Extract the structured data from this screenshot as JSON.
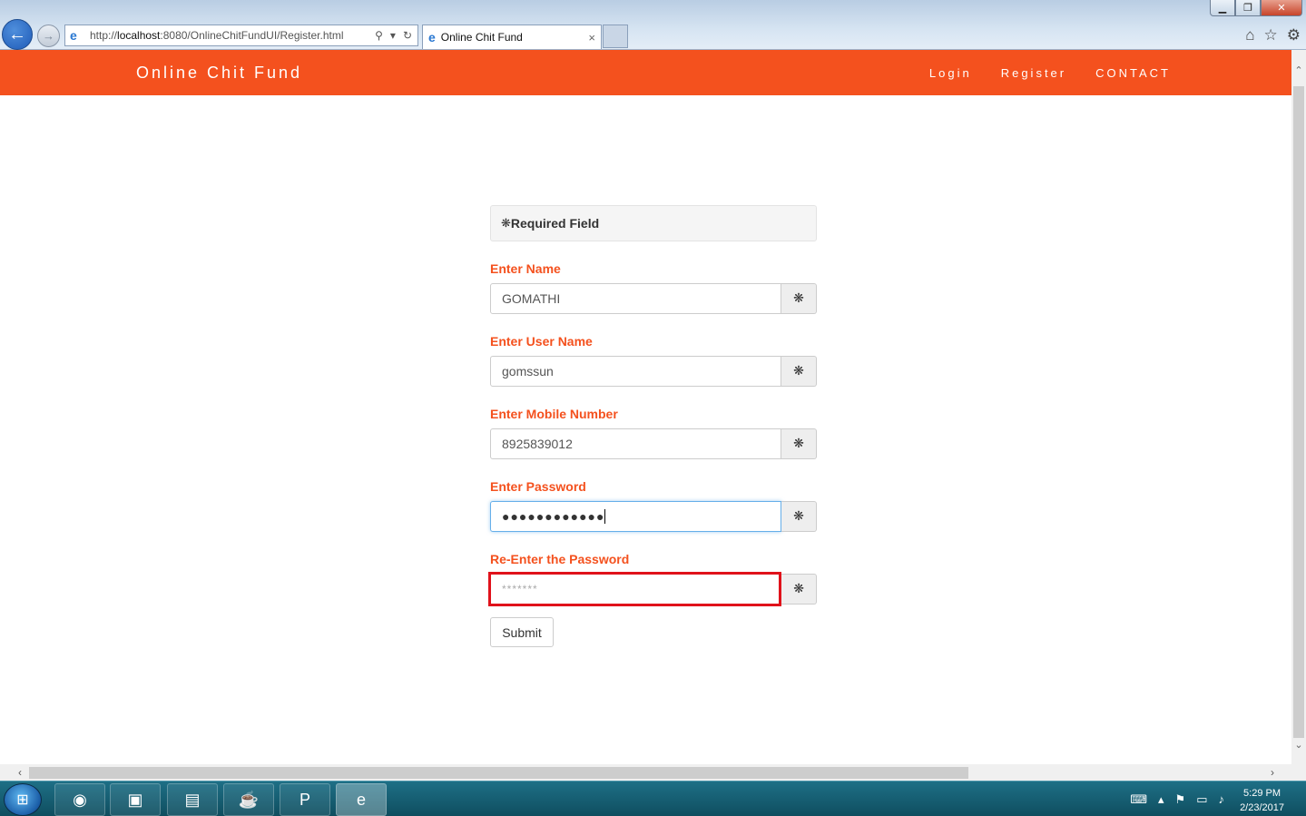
{
  "browser": {
    "url_prefix": "http://",
    "url_host": "localhost",
    "url_rest": ":8080/OnlineChitFundUI/Register.html",
    "tab_title": "Online Chit Fund",
    "tab_close": "×"
  },
  "site": {
    "brand": "Online Chit Fund",
    "nav": [
      "Login",
      "Register",
      "CONTACT"
    ]
  },
  "form": {
    "required_note": "Required Field",
    "required_mark": "❋",
    "fields": [
      {
        "label": "Enter Name",
        "value": "GOMATHI"
      },
      {
        "label": "Enter User Name",
        "value": "gomssun"
      },
      {
        "label": "Enter Mobile Number",
        "value": "8925839012"
      },
      {
        "label": "Enter Password",
        "value": "●●●●●●●●●●●●"
      },
      {
        "label": "Re-Enter the Password",
        "placeholder": "*******"
      }
    ],
    "submit_label": "Submit"
  },
  "taskbar": {
    "time": "5:29 PM",
    "date": "2/23/2017"
  }
}
